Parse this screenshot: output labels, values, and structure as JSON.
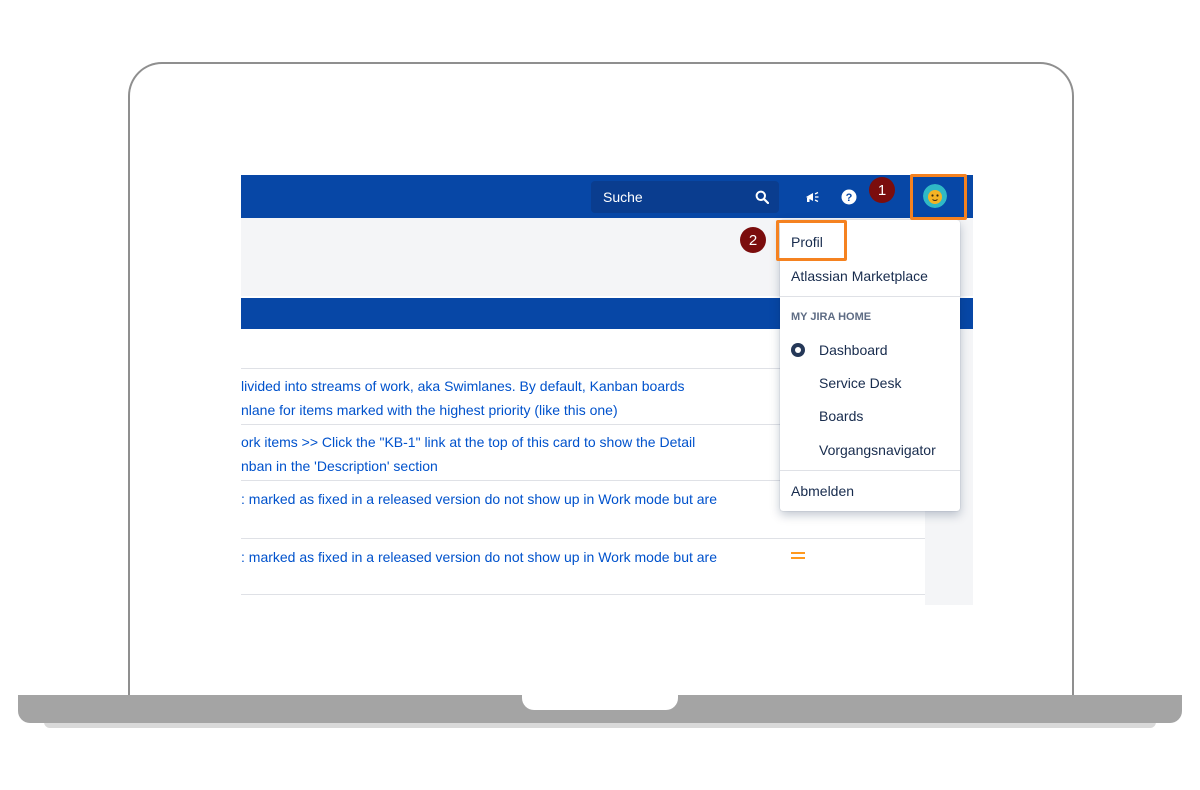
{
  "topbar": {
    "search_placeholder": "Suche",
    "icons": [
      "megaphone-icon",
      "help-icon",
      "avatar-icon"
    ]
  },
  "issues": [
    {
      "lines": [
        "livided into streams of work, aka Swimlanes. By default, Kanban boards",
        "nlane for items marked with the highest priority (like this one)"
      ],
      "priority": ""
    },
    {
      "lines": [
        "ork items >> Click the \"KB-1\" link at the top of this card to show the Detail",
        "nban in the 'Description' section"
      ],
      "priority": ""
    },
    {
      "lines": [
        ": marked as fixed in a released version do not show up in Work mode but are"
      ],
      "priority": ""
    },
    {
      "lines": [
        ": marked as fixed in a released version do not show up in Work mode but are"
      ],
      "priority": "medium"
    }
  ],
  "dropdown": {
    "profile": "Profil",
    "marketplace": "Atlassian Marketplace",
    "section_label": "MY JIRA HOME",
    "home_options": [
      "Dashboard",
      "Service Desk",
      "Boards",
      "Vorgangsnavigator"
    ],
    "selected_option": "Dashboard",
    "logout": "Abmelden"
  },
  "annotations": {
    "step1": "1",
    "step2": "2"
  },
  "colors": {
    "topbar": "#0747a6",
    "highlight": "#f58220",
    "badge": "#7b0d0d",
    "link": "#0052cc",
    "priority": "#ff991f"
  }
}
